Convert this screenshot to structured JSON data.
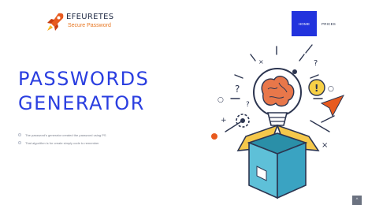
{
  "header": {
    "brand_name": "EFEURETES",
    "brand_tagline": "Secure Password",
    "logo_icon": "rocket-icon",
    "nav": [
      {
        "label": "HOME",
        "active": true
      },
      {
        "label": "PRICES",
        "active": false
      }
    ],
    "accent_color": "#2233dd"
  },
  "hero": {
    "title_line1": "PASSWORDS",
    "title_line2": "GENERATOR",
    "features": [
      "The password's generator created the password using PS",
      "That algorithm is for create simply code to remember"
    ],
    "illustration_icon": "idea-box-brain-icon"
  },
  "scroll_top_icon": "chevron-up-icon"
}
